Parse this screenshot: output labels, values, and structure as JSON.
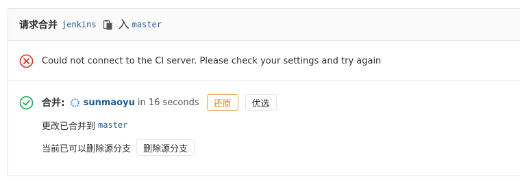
{
  "header": {
    "title": "请求合并",
    "source_branch": "jenkins",
    "arrow_label": "入",
    "target_branch": "master",
    "copy_icon": "clipboard-icon"
  },
  "ci_error": {
    "icon": "x-circle-icon",
    "icon_color": "#d22f22",
    "message": "Could not connect to the CI server. Please check your settings and try again"
  },
  "merge": {
    "icon": "check-circle-icon",
    "icon_color": "#1aaa55",
    "label": "合并:",
    "user": "sunmaoyu",
    "time": "in 16 seconds",
    "revert_label": "还原",
    "cherry_pick_label": "优选",
    "merged_into_text": "更改已合并到",
    "merged_into_branch": "master",
    "remove_branch_text": "当前已可以删除源分支",
    "remove_branch_label": "删除源分支"
  },
  "colors": {
    "link": "#1f5a92",
    "revert_border": "#e8a34e",
    "border": "#e5e5e5"
  }
}
